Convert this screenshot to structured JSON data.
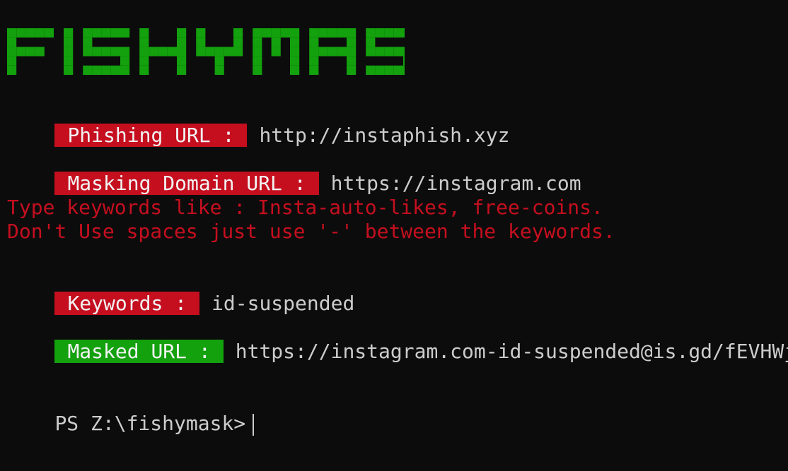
{
  "banner": {
    "text": "FISHYMASK",
    "color": "#13a10e"
  },
  "colors": {
    "background": "#0c0c0c",
    "label_red": "#c50f1f",
    "label_green": "#13a10e",
    "text": "#cccccc"
  },
  "phishing": {
    "label": "Phishing URL :",
    "value": "http://instaphish.xyz"
  },
  "masking": {
    "label": "Masking Domain URL :",
    "value": "https://instagram.com"
  },
  "hint": {
    "line1": "Type keywords like : Insta-auto-likes, free-coins.",
    "line2": "Don't Use spaces just use '-' between the keywords."
  },
  "keywords": {
    "label": "Keywords :",
    "value": "id-suspended"
  },
  "masked": {
    "label": "Masked URL :",
    "value": "https://instagram.com-id-suspended@is.gd/fEVHWj"
  },
  "prompt": {
    "text": "PS Z:\\fishymask>"
  }
}
